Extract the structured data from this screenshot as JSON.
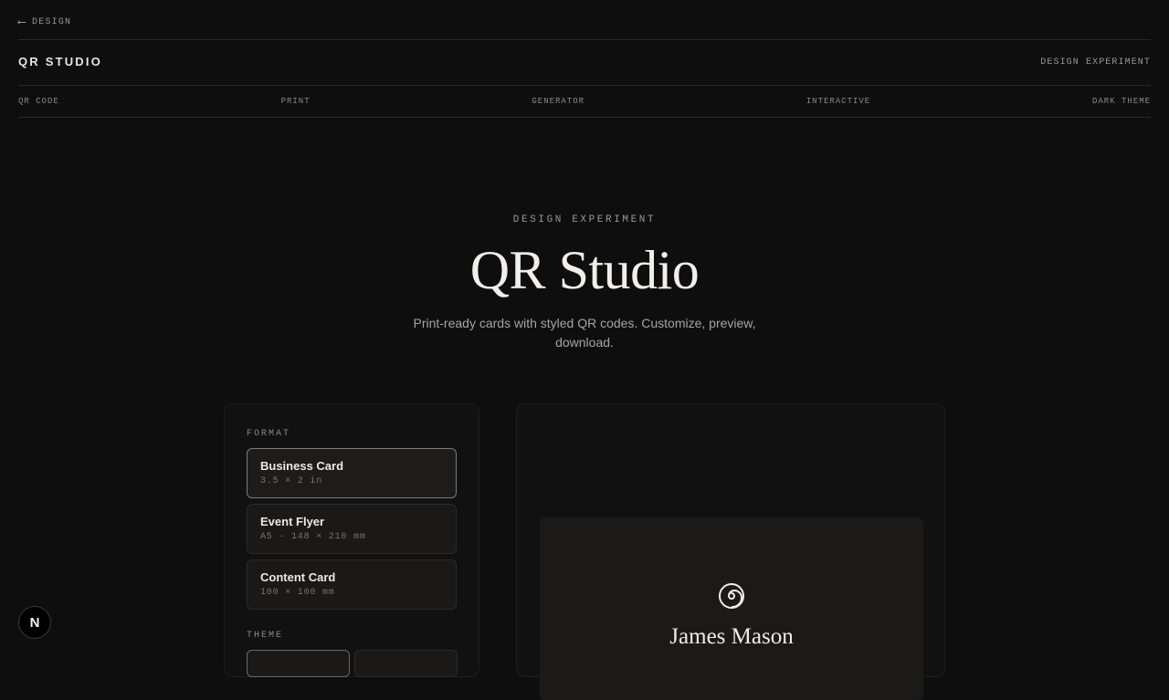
{
  "nav": {
    "back_label": "DESIGN"
  },
  "header": {
    "brand": "QR STUDIO",
    "tag": "DESIGN EXPERIMENT"
  },
  "tags": [
    "QR CODE",
    "PRINT",
    "GENERATOR",
    "INTERACTIVE",
    "DARK THEME"
  ],
  "hero": {
    "eyebrow": "DESIGN EXPERIMENT",
    "title": "QR Studio",
    "subtitle": "Print-ready cards with styled QR codes. Customize, preview, download."
  },
  "format": {
    "label": "FORMAT",
    "options": [
      {
        "name": "Business Card",
        "dims": "3.5 × 2 in",
        "selected": true
      },
      {
        "name": "Event Flyer",
        "dims": "A5 · 148 × 210 mm",
        "selected": false
      },
      {
        "name": "Content Card",
        "dims": "100 × 100 mm",
        "selected": false
      }
    ]
  },
  "theme": {
    "label": "THEME"
  },
  "preview": {
    "name": "James Mason",
    "icon": "spiral-icon"
  },
  "badge": {
    "letter": "N"
  },
  "colors": {
    "background": "#0e0e0e",
    "panel": "#111111",
    "card": "#1b1a18",
    "text": "#e8e6e1"
  }
}
